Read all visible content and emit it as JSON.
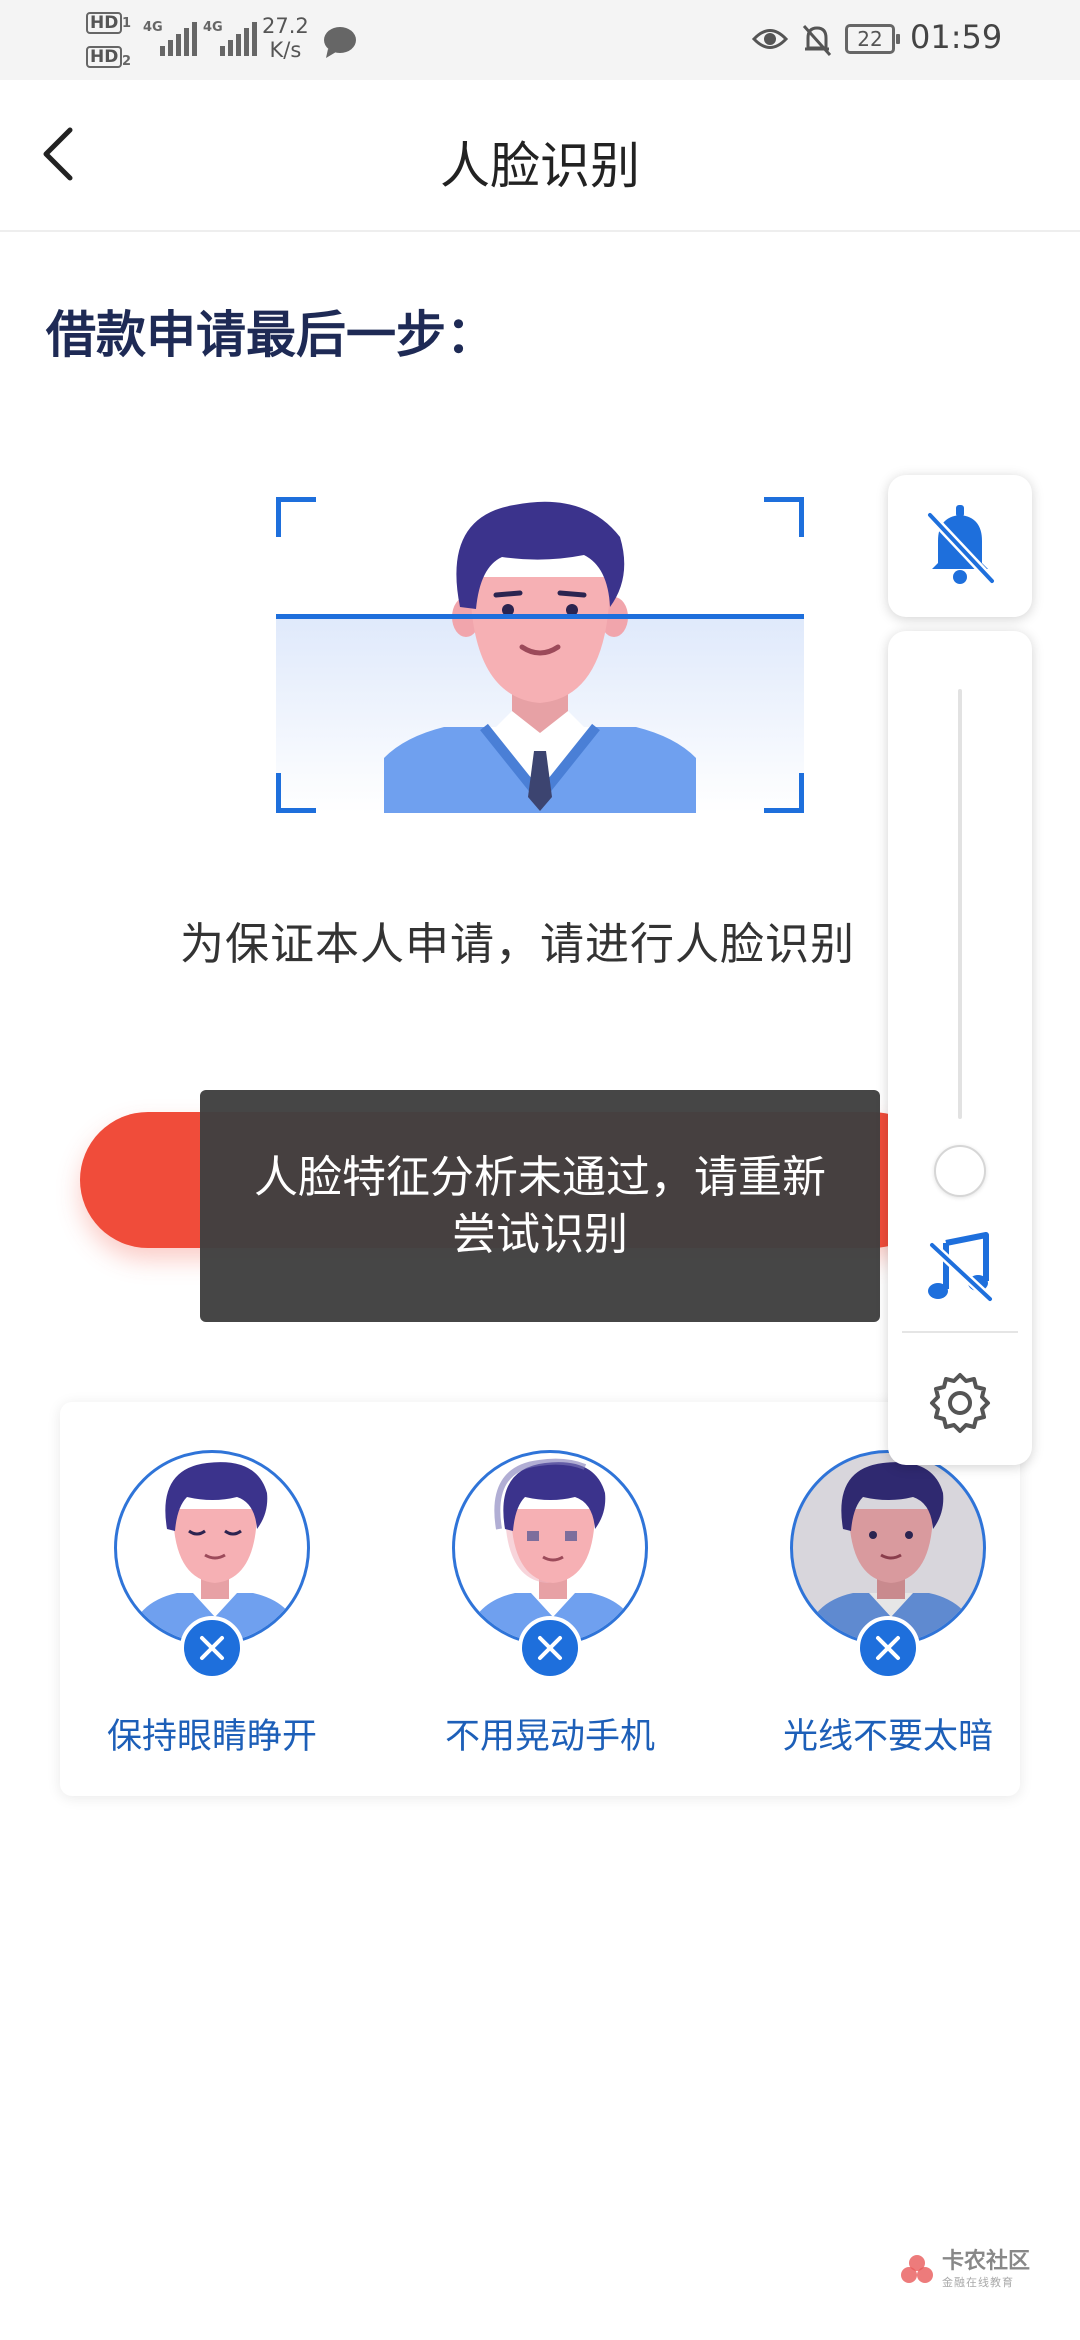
{
  "status_bar": {
    "hd1": "HD",
    "hd2": "HD",
    "net_speed": "27.2",
    "net_unit": "K/s",
    "battery": "22",
    "time": "01:59"
  },
  "header": {
    "title": "人脸识别"
  },
  "section_title": "借款申请最后一步：",
  "instruction": "为保证本人申请，请进行人脸识别",
  "toast": {
    "message": "人脸特征分析未通过，请重新尝试识别"
  },
  "tips": [
    {
      "label": "保持眼睛睁开"
    },
    {
      "label": "不用晃动手机"
    },
    {
      "label": "光线不要太暗"
    }
  ],
  "watermark": {
    "name": "卡农社区",
    "sub": "金融在线教育"
  },
  "colors": {
    "accent_blue": "#1e6fdc",
    "button_red": "#f04c3a",
    "title_navy": "#1e2a55"
  },
  "icons": [
    "back-arrow-icon",
    "bell-off-icon",
    "music-off-icon",
    "gear-icon",
    "close-x-icon"
  ]
}
